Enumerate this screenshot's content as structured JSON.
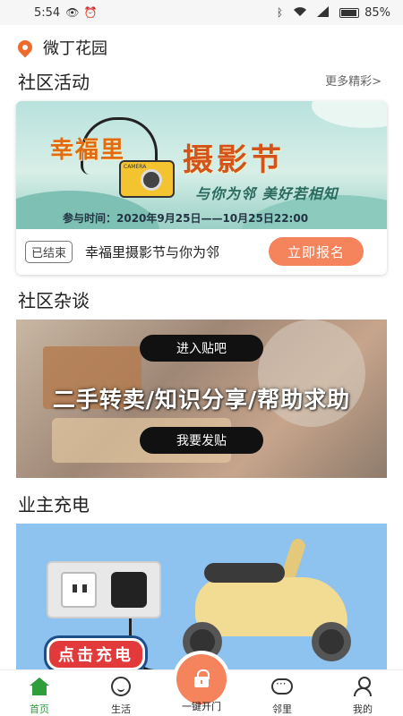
{
  "status_bar": {
    "time": "5:54",
    "battery": "85%",
    "battery_level": 0.85
  },
  "header": {
    "location_name": "微丁花园"
  },
  "community_events": {
    "title": "社区活动",
    "more_label": "更多精彩>",
    "card": {
      "banner_title_a": "幸福里",
      "banner_title_b": "摄影节",
      "banner_tagline": "与你为邻 美好若相知",
      "banner_camera_text": "CAMERA",
      "banner_date": "参与时间：2020年9月25日——10月25日22:00",
      "status_badge": "已结束",
      "event_name": "幸福里摄影节与你为邻",
      "signup_label": "立即报名"
    }
  },
  "community_forum": {
    "title": "社区杂谈",
    "enter_label": "进入贴吧",
    "headline": "二手转卖/知识分享/帮助求助",
    "post_label": "我要发贴"
  },
  "owner_charging": {
    "title": "业主充电",
    "banner_label": "点击充电"
  },
  "tabbar": {
    "home": "首页",
    "life": "生活",
    "unlock": "一键开门",
    "neighbors": "邻里",
    "mine": "我的"
  },
  "colors": {
    "accent": "#f5835c",
    "active_tab": "#2e9d3c",
    "location_pin": "#f06a2b"
  }
}
